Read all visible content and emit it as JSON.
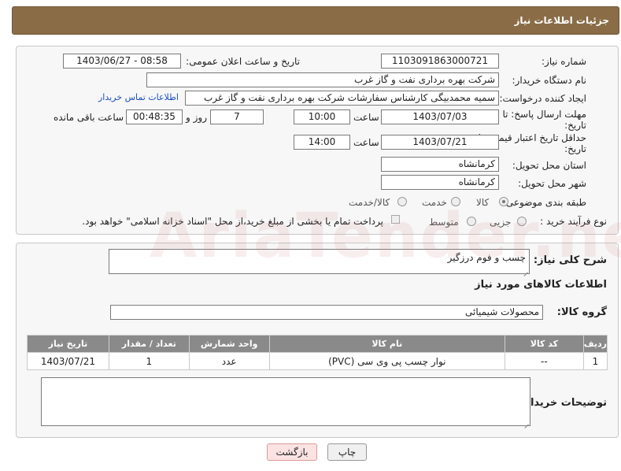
{
  "header": {
    "title": "جزئیات اطلاعات نیاز"
  },
  "form": {
    "need_number_label": "شماره نیاز:",
    "need_number": "1103091863000721",
    "announce_label": "تاریخ و ساعت اعلان عمومی:",
    "announce_value": "1403/06/27 - 08:58",
    "buyer_org_label": "نام دستگاه خریدار:",
    "buyer_org": "شرکت بهره برداری نفت و گاز غرب",
    "creator_label": "ایجاد کننده درخواست:",
    "creator": "سمیه محمدبیگی کارشناس سفارشات شرکت بهره برداری نفت و گاز غرب",
    "contact_link": "اطلاعات تماس خریدار",
    "deadline_label_1": "مهلت ارسال پاسخ: تا",
    "deadline_label_2": "تاریخ:",
    "deadline_date": "1403/07/03",
    "time_label": "ساعت",
    "deadline_time": "10:00",
    "days_value": "7",
    "days_label": "روز و",
    "remaining_time": "00:48:35",
    "remaining_label": "ساعت باقی مانده",
    "price_validity_label_1": "حداقل تاریخ اعتبار قیمت: تا",
    "price_validity_label_2": "تاریخ:",
    "price_date": "1403/07/21",
    "price_time": "14:00",
    "province_label": "استان محل تحویل:",
    "province": "کرمانشاه",
    "city_label": "شهر محل تحویل:",
    "city": "کرمانشاه",
    "category_label": "طبقه بندی موضوعی:",
    "category_options": [
      "کالا",
      "خدمت",
      "کالا/خدمت"
    ],
    "process_label": "نوع فرآیند خرید :",
    "process_options": [
      "جزیی",
      "متوسط"
    ],
    "payment_note": "پرداخت تمام یا بخشی از مبلغ خرید،از محل \"اسناد خزانه اسلامی\" خواهد بود."
  },
  "details": {
    "summary_label": "شرح کلی نیاز:",
    "summary": "چسب و فوم درزگیر",
    "goods_info_title": "اطلاعات کالاهای مورد نیاز",
    "group_label": "گروه کالا:",
    "group": "محصولات شیمیائی",
    "table": {
      "headers": [
        "ردیف",
        "کد کالا",
        "نام کالا",
        "واحد شمارش",
        "تعداد / مقدار",
        "تاریخ نیاز"
      ],
      "rows": [
        [
          "1",
          "--",
          "نوار چسب پی وی سی (PVC)",
          "عدد",
          "1",
          "1403/07/21"
        ]
      ]
    },
    "buyer_notes_label": "توضیحات خریدار:"
  },
  "buttons": {
    "print": "چاپ",
    "back": "بازگشت"
  },
  "watermark": "AriaTender.neT"
}
